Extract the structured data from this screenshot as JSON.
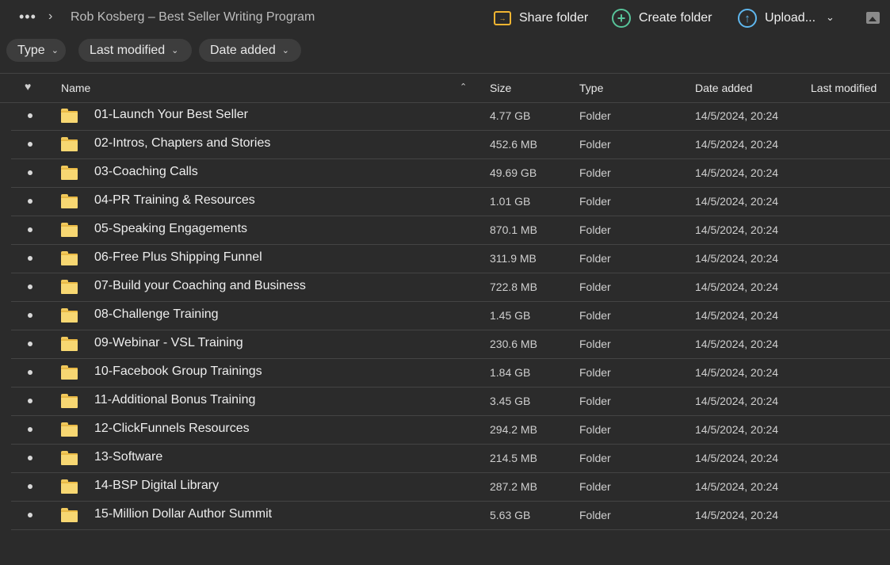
{
  "breadcrumb": {
    "more": "•••",
    "separator": "›",
    "title": "Rob Kosberg – Best Seller Writing Program"
  },
  "actions": {
    "share": "Share folder",
    "create": "Create folder",
    "upload": "Upload..."
  },
  "filters": {
    "type": "Type",
    "last_modified": "Last modified",
    "date_added": "Date added"
  },
  "columns": {
    "name": "Name",
    "size": "Size",
    "type": "Type",
    "date_added": "Date added",
    "last_modified": "Last modified"
  },
  "rows": [
    {
      "name": "01-Launch Your Best Seller",
      "size": "4.77 GB",
      "type": "Folder",
      "date_added": "14/5/2024, 20:24"
    },
    {
      "name": "02-Intros, Chapters and Stories",
      "size": "452.6 MB",
      "type": "Folder",
      "date_added": "14/5/2024, 20:24"
    },
    {
      "name": "03-Coaching Calls",
      "size": "49.69 GB",
      "type": "Folder",
      "date_added": "14/5/2024, 20:24"
    },
    {
      "name": "04-PR Training & Resources",
      "size": "1.01 GB",
      "type": "Folder",
      "date_added": "14/5/2024, 20:24"
    },
    {
      "name": "05-Speaking Engagements",
      "size": "870.1 MB",
      "type": "Folder",
      "date_added": "14/5/2024, 20:24"
    },
    {
      "name": "06-Free Plus Shipping Funnel",
      "size": "311.9 MB",
      "type": "Folder",
      "date_added": "14/5/2024, 20:24"
    },
    {
      "name": "07-Build your Coaching and Business",
      "size": "722.8 MB",
      "type": "Folder",
      "date_added": "14/5/2024, 20:24"
    },
    {
      "name": "08-Challenge Training",
      "size": "1.45 GB",
      "type": "Folder",
      "date_added": "14/5/2024, 20:24"
    },
    {
      "name": "09-Webinar - VSL Training",
      "size": "230.6 MB",
      "type": "Folder",
      "date_added": "14/5/2024, 20:24"
    },
    {
      "name": "10-Facebook Group Trainings",
      "size": "1.84 GB",
      "type": "Folder",
      "date_added": "14/5/2024, 20:24"
    },
    {
      "name": "11-Additional Bonus Training",
      "size": "3.45 GB",
      "type": "Folder",
      "date_added": "14/5/2024, 20:24"
    },
    {
      "name": "12-ClickFunnels Resources",
      "size": "294.2 MB",
      "type": "Folder",
      "date_added": "14/5/2024, 20:24"
    },
    {
      "name": "13-Software",
      "size": "214.5 MB",
      "type": "Folder",
      "date_added": "14/5/2024, 20:24"
    },
    {
      "name": "14-BSP Digital Library",
      "size": "287.2 MB",
      "type": "Folder",
      "date_added": "14/5/2024, 20:24"
    },
    {
      "name": "15-Million Dollar Author Summit",
      "size": "5.63 GB",
      "type": "Folder",
      "date_added": "14/5/2024, 20:24"
    }
  ]
}
